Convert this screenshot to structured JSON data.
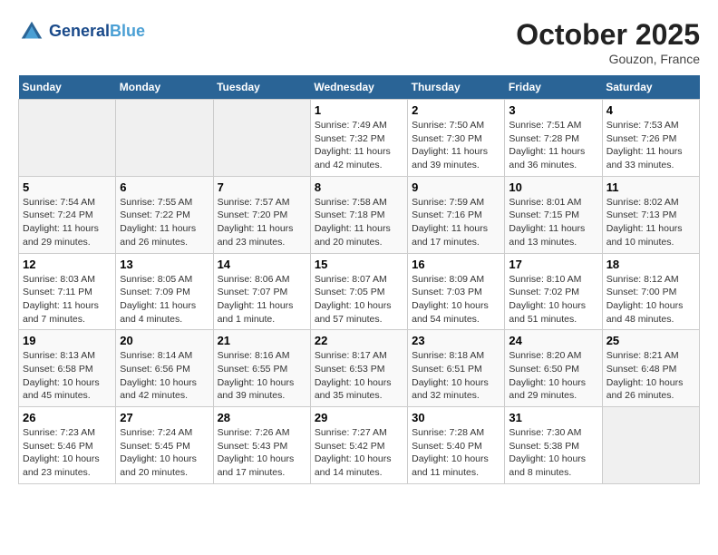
{
  "header": {
    "logo_line1": "General",
    "logo_line2": "Blue",
    "month": "October 2025",
    "location": "Gouzon, France"
  },
  "weekdays": [
    "Sunday",
    "Monday",
    "Tuesday",
    "Wednesday",
    "Thursday",
    "Friday",
    "Saturday"
  ],
  "weeks": [
    [
      {
        "day": "",
        "info": ""
      },
      {
        "day": "",
        "info": ""
      },
      {
        "day": "",
        "info": ""
      },
      {
        "day": "1",
        "info": "Sunrise: 7:49 AM\nSunset: 7:32 PM\nDaylight: 11 hours and 42 minutes."
      },
      {
        "day": "2",
        "info": "Sunrise: 7:50 AM\nSunset: 7:30 PM\nDaylight: 11 hours and 39 minutes."
      },
      {
        "day": "3",
        "info": "Sunrise: 7:51 AM\nSunset: 7:28 PM\nDaylight: 11 hours and 36 minutes."
      },
      {
        "day": "4",
        "info": "Sunrise: 7:53 AM\nSunset: 7:26 PM\nDaylight: 11 hours and 33 minutes."
      }
    ],
    [
      {
        "day": "5",
        "info": "Sunrise: 7:54 AM\nSunset: 7:24 PM\nDaylight: 11 hours and 29 minutes."
      },
      {
        "day": "6",
        "info": "Sunrise: 7:55 AM\nSunset: 7:22 PM\nDaylight: 11 hours and 26 minutes."
      },
      {
        "day": "7",
        "info": "Sunrise: 7:57 AM\nSunset: 7:20 PM\nDaylight: 11 hours and 23 minutes."
      },
      {
        "day": "8",
        "info": "Sunrise: 7:58 AM\nSunset: 7:18 PM\nDaylight: 11 hours and 20 minutes."
      },
      {
        "day": "9",
        "info": "Sunrise: 7:59 AM\nSunset: 7:16 PM\nDaylight: 11 hours and 17 minutes."
      },
      {
        "day": "10",
        "info": "Sunrise: 8:01 AM\nSunset: 7:15 PM\nDaylight: 11 hours and 13 minutes."
      },
      {
        "day": "11",
        "info": "Sunrise: 8:02 AM\nSunset: 7:13 PM\nDaylight: 11 hours and 10 minutes."
      }
    ],
    [
      {
        "day": "12",
        "info": "Sunrise: 8:03 AM\nSunset: 7:11 PM\nDaylight: 11 hours and 7 minutes."
      },
      {
        "day": "13",
        "info": "Sunrise: 8:05 AM\nSunset: 7:09 PM\nDaylight: 11 hours and 4 minutes."
      },
      {
        "day": "14",
        "info": "Sunrise: 8:06 AM\nSunset: 7:07 PM\nDaylight: 11 hours and 1 minute."
      },
      {
        "day": "15",
        "info": "Sunrise: 8:07 AM\nSunset: 7:05 PM\nDaylight: 10 hours and 57 minutes."
      },
      {
        "day": "16",
        "info": "Sunrise: 8:09 AM\nSunset: 7:03 PM\nDaylight: 10 hours and 54 minutes."
      },
      {
        "day": "17",
        "info": "Sunrise: 8:10 AM\nSunset: 7:02 PM\nDaylight: 10 hours and 51 minutes."
      },
      {
        "day": "18",
        "info": "Sunrise: 8:12 AM\nSunset: 7:00 PM\nDaylight: 10 hours and 48 minutes."
      }
    ],
    [
      {
        "day": "19",
        "info": "Sunrise: 8:13 AM\nSunset: 6:58 PM\nDaylight: 10 hours and 45 minutes."
      },
      {
        "day": "20",
        "info": "Sunrise: 8:14 AM\nSunset: 6:56 PM\nDaylight: 10 hours and 42 minutes."
      },
      {
        "day": "21",
        "info": "Sunrise: 8:16 AM\nSunset: 6:55 PM\nDaylight: 10 hours and 39 minutes."
      },
      {
        "day": "22",
        "info": "Sunrise: 8:17 AM\nSunset: 6:53 PM\nDaylight: 10 hours and 35 minutes."
      },
      {
        "day": "23",
        "info": "Sunrise: 8:18 AM\nSunset: 6:51 PM\nDaylight: 10 hours and 32 minutes."
      },
      {
        "day": "24",
        "info": "Sunrise: 8:20 AM\nSunset: 6:50 PM\nDaylight: 10 hours and 29 minutes."
      },
      {
        "day": "25",
        "info": "Sunrise: 8:21 AM\nSunset: 6:48 PM\nDaylight: 10 hours and 26 minutes."
      }
    ],
    [
      {
        "day": "26",
        "info": "Sunrise: 7:23 AM\nSunset: 5:46 PM\nDaylight: 10 hours and 23 minutes."
      },
      {
        "day": "27",
        "info": "Sunrise: 7:24 AM\nSunset: 5:45 PM\nDaylight: 10 hours and 20 minutes."
      },
      {
        "day": "28",
        "info": "Sunrise: 7:26 AM\nSunset: 5:43 PM\nDaylight: 10 hours and 17 minutes."
      },
      {
        "day": "29",
        "info": "Sunrise: 7:27 AM\nSunset: 5:42 PM\nDaylight: 10 hours and 14 minutes."
      },
      {
        "day": "30",
        "info": "Sunrise: 7:28 AM\nSunset: 5:40 PM\nDaylight: 10 hours and 11 minutes."
      },
      {
        "day": "31",
        "info": "Sunrise: 7:30 AM\nSunset: 5:38 PM\nDaylight: 10 hours and 8 minutes."
      },
      {
        "day": "",
        "info": ""
      }
    ]
  ]
}
